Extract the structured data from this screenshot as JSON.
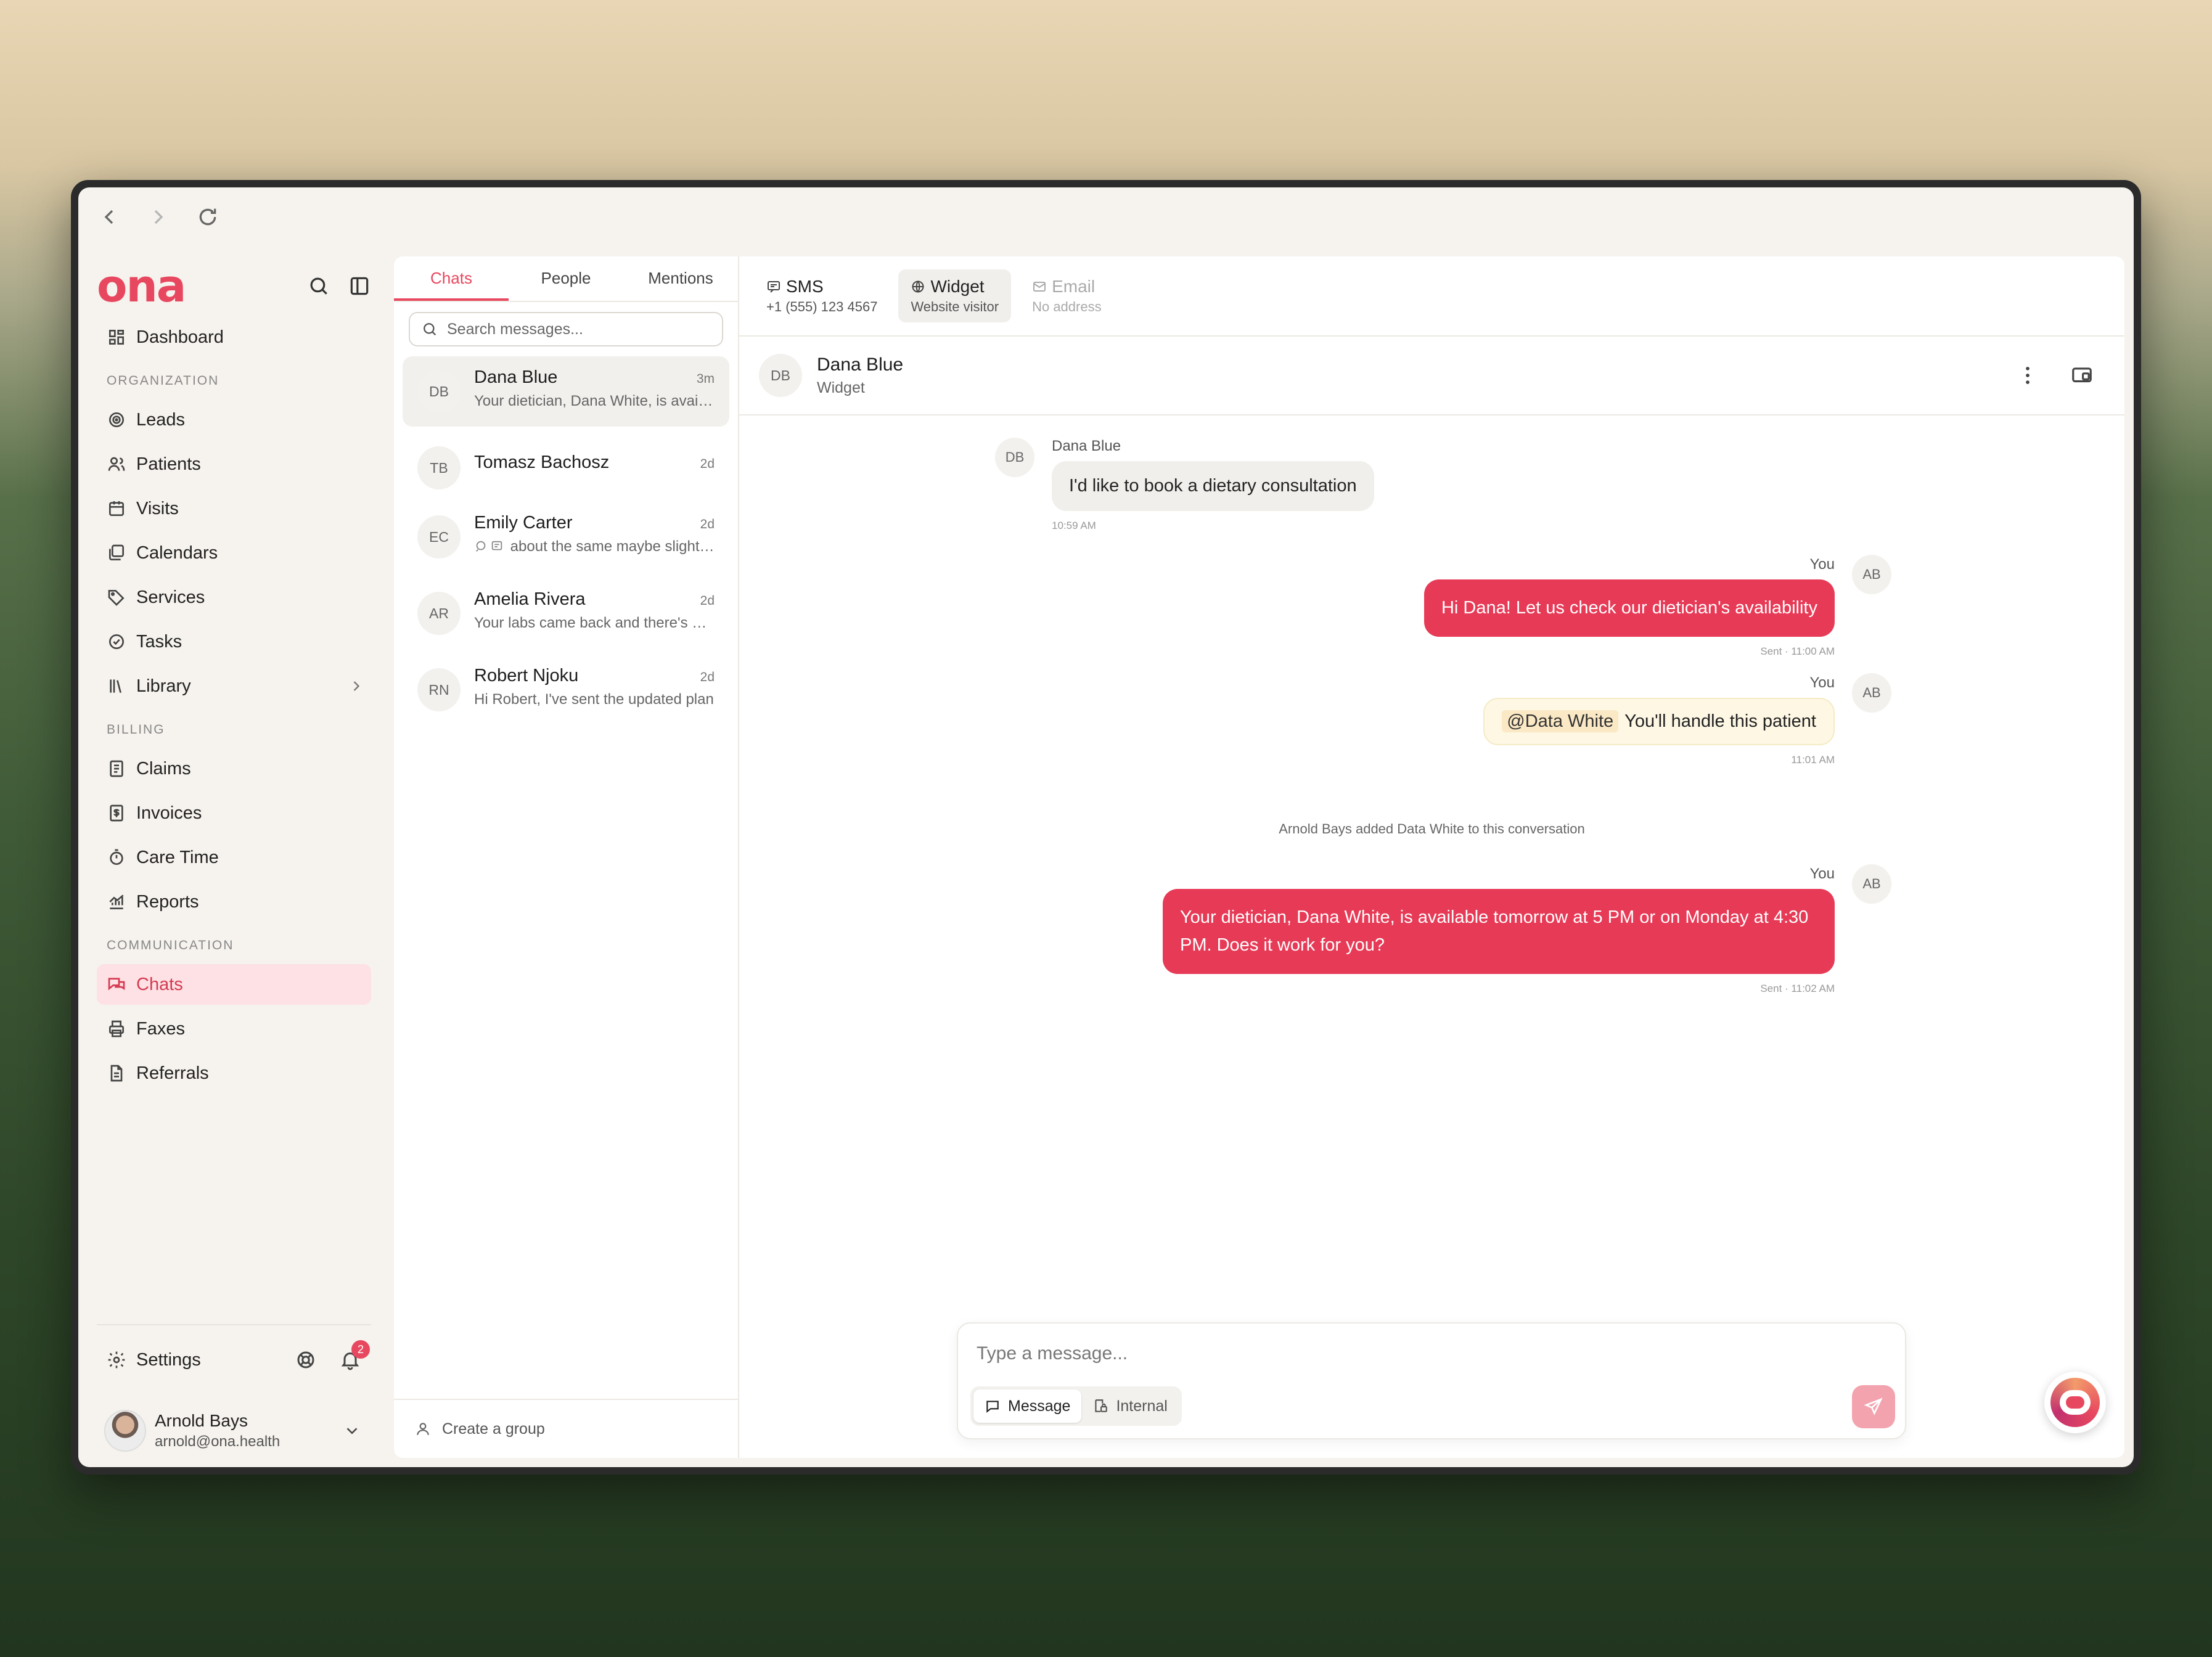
{
  "brand": {
    "logo": "ona",
    "accent": "#e8485f"
  },
  "nav": {
    "dashboard": "Dashboard",
    "sections": {
      "organization": "ORGANIZATION",
      "billing": "BILLING",
      "communication": "COMMUNICATION"
    },
    "organization_items": [
      "Leads",
      "Patients",
      "Visits",
      "Calendars",
      "Services",
      "Tasks",
      "Library"
    ],
    "billing_items": [
      "Claims",
      "Invoices",
      "Care Time",
      "Reports"
    ],
    "communication_items": [
      "Chats",
      "Faxes",
      "Referrals"
    ],
    "settings": "Settings",
    "notification_count": "2",
    "user": {
      "name": "Arnold Bays",
      "email": "arnold@ona.health"
    }
  },
  "list": {
    "tabs": [
      "Chats",
      "People",
      "Mentions"
    ],
    "search_placeholder": "Search messages...",
    "chats": [
      {
        "initials": "DB",
        "name": "Dana Blue",
        "time": "3m",
        "preview": "Your dietician, Dana White, is available tomorrow"
      },
      {
        "initials": "TB",
        "name": "Tomasz Bachosz",
        "time": "2d",
        "preview": ""
      },
      {
        "initials": "EC",
        "name": "Emily Carter",
        "time": "2d",
        "preview": "about the same maybe slightly better"
      },
      {
        "initials": "AR",
        "name": "Amelia Rivera",
        "time": "2d",
        "preview": "Your labs came back and there's nothing"
      },
      {
        "initials": "RN",
        "name": "Robert Njoku",
        "time": "2d",
        "preview": "Hi Robert, I've sent the updated plan"
      }
    ],
    "create_group": "Create a group"
  },
  "channels": [
    {
      "title": "SMS",
      "sub": "+1 (555) 123 4567",
      "icon": "sms-icon"
    },
    {
      "title": "Widget",
      "sub": "Website visitor",
      "icon": "globe-icon"
    },
    {
      "title": "Email",
      "sub": "No address",
      "icon": "mail-icon"
    }
  ],
  "conversation": {
    "contact_initials": "DB",
    "contact_name": "Dana Blue",
    "contact_channel": "Widget",
    "incoming": {
      "sender": "Dana Blue",
      "text": "I'd like to book a dietary consultation",
      "time": "10:59 AM"
    },
    "out1": {
      "sender": "You",
      "initials": "AB",
      "text": "Hi Dana! Let us check our dietician's availability",
      "time": "Sent · 11:00 AM"
    },
    "note": {
      "sender": "You",
      "initials": "AB",
      "mention": "@Data White",
      "text": "You'll handle this patient",
      "time": "11:01 AM"
    },
    "system": "Arnold Bays added Data White to this conversation",
    "out2": {
      "sender": "You",
      "initials": "AB",
      "text": "Your dietician, Dana White, is available tomorrow at 5 PM or on Monday at 4:30 PM. Does it work for you?",
      "time": "Sent · 11:02 AM"
    }
  },
  "composer": {
    "placeholder": "Type a message...",
    "mode_message": "Message",
    "mode_internal": "Internal"
  }
}
